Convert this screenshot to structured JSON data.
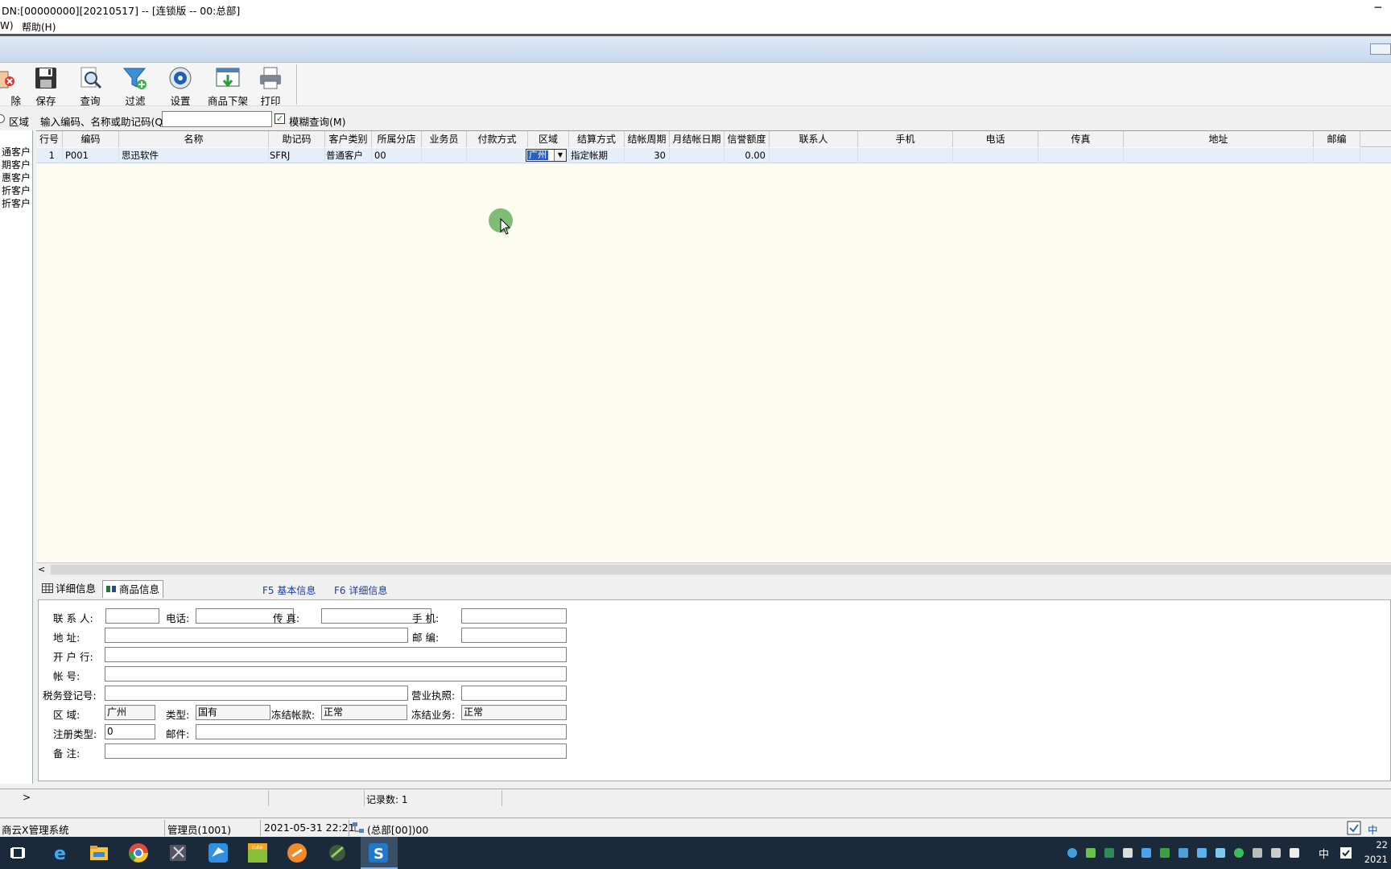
{
  "window": {
    "title": "DN:[00000000][20210517] -- [连锁版 -- 00:总部]",
    "minimize": "─"
  },
  "menu": {
    "items": [
      "W)",
      "帮助(H)"
    ]
  },
  "toolbar": {
    "buttons": [
      {
        "label": "除",
        "icon": "delete-icon"
      },
      {
        "label": "保存",
        "icon": "save-disk-icon"
      },
      {
        "label": "查询",
        "icon": "magnifier-icon"
      },
      {
        "label": "过滤",
        "icon": "funnel-icon"
      },
      {
        "label": "设置",
        "icon": "settings-icon"
      },
      {
        "label": "商品下架",
        "icon": "window-down-arrow-icon"
      },
      {
        "label": "打印",
        "icon": "printer-icon"
      }
    ]
  },
  "search": {
    "region_label": "区域",
    "input_label": "输入编码、名称或助记码(Q)",
    "input_value": "",
    "fuzzy_label": "模糊查询(M)",
    "fuzzy_checked": true
  },
  "left_panel": {
    "items": [
      "通客户",
      "期客户",
      "惠客户",
      "折客户",
      "折客户"
    ]
  },
  "grid": {
    "columns": [
      "行号",
      "编码",
      "名称",
      "助记码",
      "客户类别",
      "所属分店",
      "业务员",
      "付款方式",
      "区域",
      "结算方式",
      "结帐周期",
      "月结帐日期",
      "信誉额度",
      "联系人",
      "手机",
      "电话",
      "传真",
      "地址",
      "邮编"
    ],
    "rows": [
      {
        "row_no": "1",
        "code": "P001",
        "name": "思迅软件",
        "mnemonic": "SFRJ",
        "category": "普通客户",
        "branch": "00",
        "salesman": "",
        "payment": "",
        "region": "广州",
        "settlement": "指定帐期",
        "cycle": "30",
        "month_day": "",
        "credit": "0.00"
      }
    ]
  },
  "tabs": {
    "detail": "详细信息",
    "goods": "商品信息",
    "hint_f5": "F5 基本信息",
    "hint_f6": "F6 详细信息"
  },
  "form": {
    "contact_label": "联 系 人:",
    "contact_value": "",
    "phone_label": "电话:",
    "phone_value": "",
    "fax_label": "传  真:",
    "fax_value": "",
    "mobile_label": "手  机:",
    "mobile_value": "",
    "address_label": "地   址:",
    "address_value": "",
    "zip_label": "邮  编:",
    "zip_value": "",
    "bank_label": "开 户 行:",
    "bank_value": "",
    "account_label": "帐   号:",
    "account_value": "",
    "tax_label": "税务登记号:",
    "tax_value": "",
    "license_label": "营业执照:",
    "license_value": "",
    "region_label": "区   域:",
    "region_value": "广州",
    "type_label": "类型:",
    "type_value": "国有",
    "freeze_acct_label": "冻结帐款:",
    "freeze_acct_value": "正常",
    "freeze_biz_label": "冻结业务:",
    "freeze_biz_value": "正常",
    "reg_type_label": "注册类型:",
    "reg_type_value": "0",
    "email_label": "邮件:",
    "email_value": "",
    "remark_label": "备   注:",
    "remark_value": ""
  },
  "status": {
    "record_count": "记录数: 1"
  },
  "system_status": {
    "app": "商云X管理系统",
    "user": "管理员(1001)",
    "datetime": "2021-05-31 22:21",
    "branch": "(总部[00])00",
    "ime": "中"
  },
  "taskbar": {
    "apps": [
      "task-view-icon",
      "ie-icon",
      "file-explorer-icon",
      "chrome-icon",
      "tools-icon",
      "bird-app-icon",
      "cuteftp-icon",
      "orange-app-icon",
      "green-app-icon",
      "siyuan-app-icon"
    ],
    "ime": "中",
    "clock_time": "22",
    "clock_date": "2021"
  }
}
